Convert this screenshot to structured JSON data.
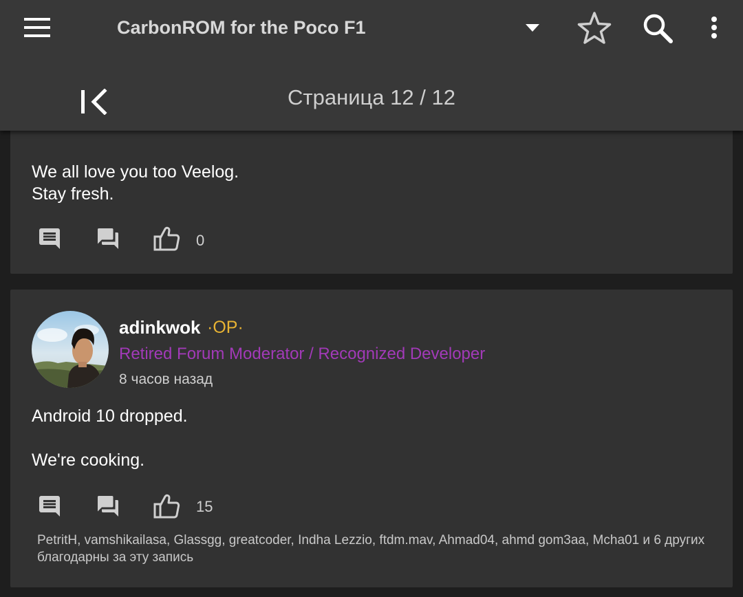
{
  "appbar": {
    "title": "CarbonROM for the Poco F1",
    "page_indicator": "Страница 12 / 12",
    "icons": {
      "menu": "menu-icon",
      "dropdown": "dropdown-arrow-icon",
      "star": "star-outline-icon",
      "search": "search-icon",
      "more": "more-vert-icon",
      "first_page": "first-page-icon"
    }
  },
  "posts": [
    {
      "lines": [
        "We all love you too Veelog.",
        "Stay fresh."
      ],
      "likes": "0"
    },
    {
      "author": "adinkwok",
      "badge": "·OP·",
      "role": "Retired Forum Moderator / Recognized Developer",
      "time": "8 часов назад",
      "lines": [
        "Android 10 dropped.",
        "We're cooking."
      ],
      "likes": "15",
      "thanks": "PetritH, vamshikailasa, Glassgg, greatcoder, Indha Lezzio, ftdm.mav, Ahmad04, ahmd gom3aa, Mcha01 и 6 других благодарны за эту запись"
    }
  ],
  "colors": {
    "appbar": "#383838",
    "card": "#323232",
    "background": "#1e1e1e",
    "op_badge": "#e8b333",
    "role": "#a23ab8"
  }
}
